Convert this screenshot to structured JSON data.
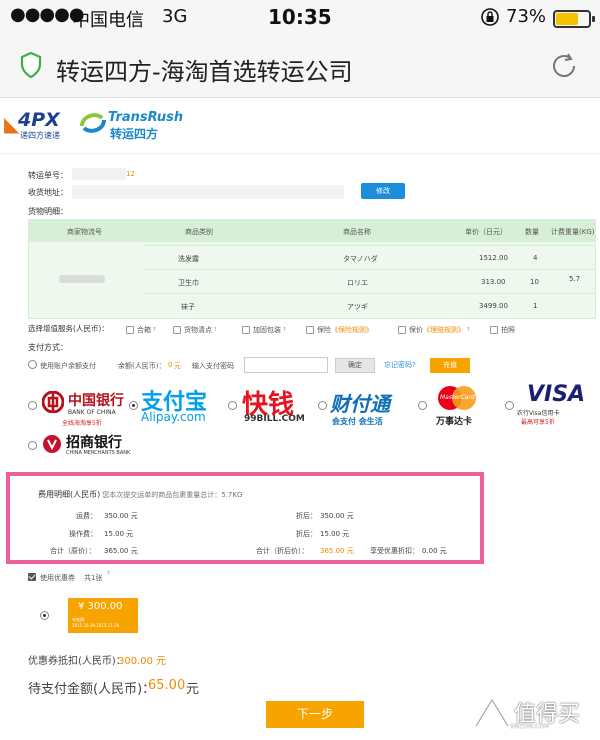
{
  "status_bar": {
    "signal": "●●●●●",
    "carrier": "中国电信",
    "network": "3G",
    "time": "10:35",
    "battery_text": "73%",
    "battery_level": 0.73
  },
  "nav": {
    "title": "转运四方-海淘首选转运公司"
  },
  "logos": {
    "fourpx": "4PX",
    "fourpx_sub": "递四方速递",
    "transrush_en": "TransRush",
    "transrush_cn": "转运四方"
  },
  "form": {
    "order_no_label": "转运单号：",
    "order_no_value": "12",
    "address_label": "收货地址：",
    "edit_label": "修改",
    "goods_label": "货物明细："
  },
  "goods_table": {
    "headers": [
      "商家物流号",
      "商品类别",
      "商品名称",
      "单价（日元）",
      "数量",
      "计费重量(KG)"
    ],
    "rows": [
      {
        "category": "洗发露",
        "name": "タマノハダ",
        "price": "1512.00",
        "qty": "4"
      },
      {
        "category": "卫生巾",
        "name": "ロリエ",
        "price": "313.00",
        "qty": "10"
      },
      {
        "category": "袜子",
        "name": "アツギ",
        "price": "3499.00",
        "qty": "1"
      }
    ],
    "weight": "5.7"
  },
  "services": {
    "label": "选择增值服务(人民币)：",
    "items": [
      {
        "label": "合箱"
      },
      {
        "label": "货物清点"
      },
      {
        "label": "加固包装"
      },
      {
        "label": "保险",
        "link": "《保险规则》"
      },
      {
        "label": "保价",
        "link": "《理赔规则》"
      },
      {
        "label": "拍照"
      }
    ]
  },
  "payment": {
    "label": "支付方式：",
    "balance_option": "使用账户余额支付",
    "balance_label": "余额(人民币)：",
    "balance_value": "0",
    "balance_unit": "元",
    "pwd_label": "输入支付密码",
    "confirm_label": "确定",
    "forgot_label": "忘记密码?",
    "recharge_label": "充值",
    "methods": {
      "boc_cn": "中国银行",
      "boc_en": "BANK OF CHINA",
      "boc_note": "全线海淘享5折",
      "alipay_cn": "支付宝",
      "alipay_en": "Alipay.com",
      "bill_cn": "快钱",
      "bill_en": "99BILL.COM",
      "cft_cn": "财付通",
      "cft_note": "会支付 会生活",
      "mc_en": "MasterCard",
      "mc_cn": "万事达卡",
      "visa_en": "VISA",
      "visa_note1": "农行Visa信用卡",
      "visa_note2": "最高可享5折",
      "cmb_cn": "招商银行",
      "cmb_en": "CHINA MERCHANTS BANK"
    }
  },
  "fees": {
    "title": "费用明细(人民币)",
    "subtitle": "您本次提交运单的商品包裹重量总计：5.7KG",
    "shipping_label": "运费：",
    "shipping_value": "350.00 元",
    "shipping_disc_label": "折后：",
    "shipping_disc_value": "350.00 元",
    "handling_label": "操作费：",
    "handling_value": "15.00 元",
    "handling_disc_label": "折后：",
    "handling_disc_value": "15.00 元",
    "total_label": "合计（原价）：",
    "total_value": "365.00 元",
    "total_disc_label": "合计（折后价）：",
    "total_disc_value": "365.00 元",
    "discount_label": "享受优惠折扣：",
    "discount_value": "0.00 元"
  },
  "coupon": {
    "use_label": "使用优惠券",
    "count": "共1张",
    "amount": "¥ 300.00",
    "valid_label": "有效期:",
    "valid_range": "2015.10.26-2015.11.26"
  },
  "summary": {
    "deduct_label": "优惠券抵扣(人民币)：",
    "deduct_value": "300.00 元",
    "pay_label": "待支付金额(人民币)：",
    "pay_value": "65.00",
    "pay_unit": "元"
  },
  "next_label": "下一步",
  "watermark": {
    "cn": "值得买",
    "en": "SMZDM.COM"
  }
}
